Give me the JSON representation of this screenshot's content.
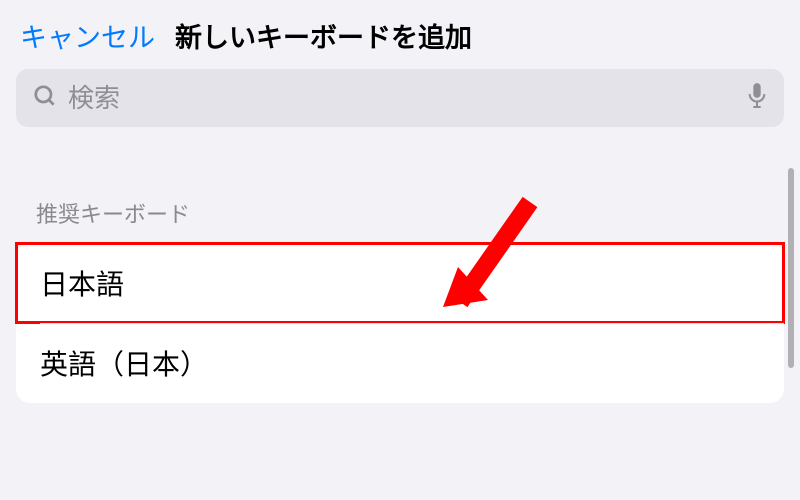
{
  "header": {
    "cancel_label": "キャンセル",
    "title": "新しいキーボードを追加"
  },
  "search": {
    "placeholder": "検索"
  },
  "section": {
    "header": "推奨キーボード",
    "items": [
      {
        "label": "日本語",
        "highlighted": true
      },
      {
        "label": "英語（日本）",
        "highlighted": false
      }
    ]
  },
  "annotation": {
    "arrow_color": "#ff0000",
    "highlight_color": "#ff0000"
  }
}
